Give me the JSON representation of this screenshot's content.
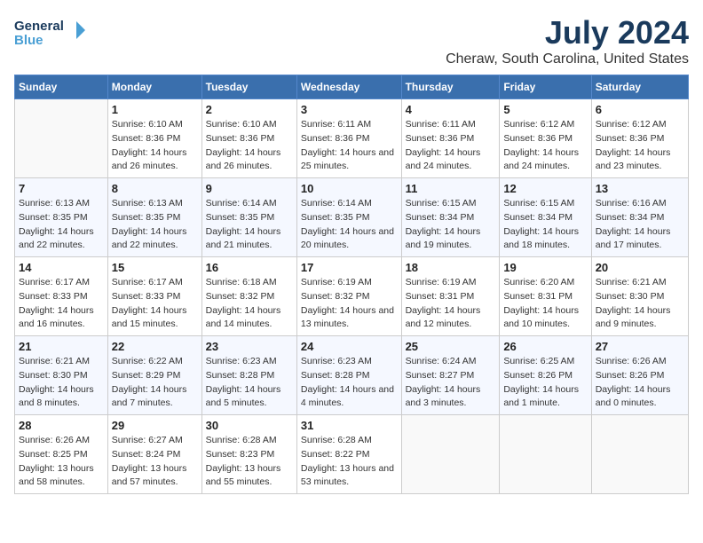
{
  "header": {
    "logo_line1": "General",
    "logo_line2": "Blue",
    "month_year": "July 2024",
    "location": "Cheraw, South Carolina, United States"
  },
  "days_of_week": [
    "Sunday",
    "Monday",
    "Tuesday",
    "Wednesday",
    "Thursday",
    "Friday",
    "Saturday"
  ],
  "weeks": [
    [
      {
        "day": "",
        "sunrise": "",
        "sunset": "",
        "daylight": ""
      },
      {
        "day": "1",
        "sunrise": "Sunrise: 6:10 AM",
        "sunset": "Sunset: 8:36 PM",
        "daylight": "Daylight: 14 hours and 26 minutes."
      },
      {
        "day": "2",
        "sunrise": "Sunrise: 6:10 AM",
        "sunset": "Sunset: 8:36 PM",
        "daylight": "Daylight: 14 hours and 26 minutes."
      },
      {
        "day": "3",
        "sunrise": "Sunrise: 6:11 AM",
        "sunset": "Sunset: 8:36 PM",
        "daylight": "Daylight: 14 hours and 25 minutes."
      },
      {
        "day": "4",
        "sunrise": "Sunrise: 6:11 AM",
        "sunset": "Sunset: 8:36 PM",
        "daylight": "Daylight: 14 hours and 24 minutes."
      },
      {
        "day": "5",
        "sunrise": "Sunrise: 6:12 AM",
        "sunset": "Sunset: 8:36 PM",
        "daylight": "Daylight: 14 hours and 24 minutes."
      },
      {
        "day": "6",
        "sunrise": "Sunrise: 6:12 AM",
        "sunset": "Sunset: 8:36 PM",
        "daylight": "Daylight: 14 hours and 23 minutes."
      }
    ],
    [
      {
        "day": "7",
        "sunrise": "Sunrise: 6:13 AM",
        "sunset": "Sunset: 8:35 PM",
        "daylight": "Daylight: 14 hours and 22 minutes."
      },
      {
        "day": "8",
        "sunrise": "Sunrise: 6:13 AM",
        "sunset": "Sunset: 8:35 PM",
        "daylight": "Daylight: 14 hours and 22 minutes."
      },
      {
        "day": "9",
        "sunrise": "Sunrise: 6:14 AM",
        "sunset": "Sunset: 8:35 PM",
        "daylight": "Daylight: 14 hours and 21 minutes."
      },
      {
        "day": "10",
        "sunrise": "Sunrise: 6:14 AM",
        "sunset": "Sunset: 8:35 PM",
        "daylight": "Daylight: 14 hours and 20 minutes."
      },
      {
        "day": "11",
        "sunrise": "Sunrise: 6:15 AM",
        "sunset": "Sunset: 8:34 PM",
        "daylight": "Daylight: 14 hours and 19 minutes."
      },
      {
        "day": "12",
        "sunrise": "Sunrise: 6:15 AM",
        "sunset": "Sunset: 8:34 PM",
        "daylight": "Daylight: 14 hours and 18 minutes."
      },
      {
        "day": "13",
        "sunrise": "Sunrise: 6:16 AM",
        "sunset": "Sunset: 8:34 PM",
        "daylight": "Daylight: 14 hours and 17 minutes."
      }
    ],
    [
      {
        "day": "14",
        "sunrise": "Sunrise: 6:17 AM",
        "sunset": "Sunset: 8:33 PM",
        "daylight": "Daylight: 14 hours and 16 minutes."
      },
      {
        "day": "15",
        "sunrise": "Sunrise: 6:17 AM",
        "sunset": "Sunset: 8:33 PM",
        "daylight": "Daylight: 14 hours and 15 minutes."
      },
      {
        "day": "16",
        "sunrise": "Sunrise: 6:18 AM",
        "sunset": "Sunset: 8:32 PM",
        "daylight": "Daylight: 14 hours and 14 minutes."
      },
      {
        "day": "17",
        "sunrise": "Sunrise: 6:19 AM",
        "sunset": "Sunset: 8:32 PM",
        "daylight": "Daylight: 14 hours and 13 minutes."
      },
      {
        "day": "18",
        "sunrise": "Sunrise: 6:19 AM",
        "sunset": "Sunset: 8:31 PM",
        "daylight": "Daylight: 14 hours and 12 minutes."
      },
      {
        "day": "19",
        "sunrise": "Sunrise: 6:20 AM",
        "sunset": "Sunset: 8:31 PM",
        "daylight": "Daylight: 14 hours and 10 minutes."
      },
      {
        "day": "20",
        "sunrise": "Sunrise: 6:21 AM",
        "sunset": "Sunset: 8:30 PM",
        "daylight": "Daylight: 14 hours and 9 minutes."
      }
    ],
    [
      {
        "day": "21",
        "sunrise": "Sunrise: 6:21 AM",
        "sunset": "Sunset: 8:30 PM",
        "daylight": "Daylight: 14 hours and 8 minutes."
      },
      {
        "day": "22",
        "sunrise": "Sunrise: 6:22 AM",
        "sunset": "Sunset: 8:29 PM",
        "daylight": "Daylight: 14 hours and 7 minutes."
      },
      {
        "day": "23",
        "sunrise": "Sunrise: 6:23 AM",
        "sunset": "Sunset: 8:28 PM",
        "daylight": "Daylight: 14 hours and 5 minutes."
      },
      {
        "day": "24",
        "sunrise": "Sunrise: 6:23 AM",
        "sunset": "Sunset: 8:28 PM",
        "daylight": "Daylight: 14 hours and 4 minutes."
      },
      {
        "day": "25",
        "sunrise": "Sunrise: 6:24 AM",
        "sunset": "Sunset: 8:27 PM",
        "daylight": "Daylight: 14 hours and 3 minutes."
      },
      {
        "day": "26",
        "sunrise": "Sunrise: 6:25 AM",
        "sunset": "Sunset: 8:26 PM",
        "daylight": "Daylight: 14 hours and 1 minute."
      },
      {
        "day": "27",
        "sunrise": "Sunrise: 6:26 AM",
        "sunset": "Sunset: 8:26 PM",
        "daylight": "Daylight: 14 hours and 0 minutes."
      }
    ],
    [
      {
        "day": "28",
        "sunrise": "Sunrise: 6:26 AM",
        "sunset": "Sunset: 8:25 PM",
        "daylight": "Daylight: 13 hours and 58 minutes."
      },
      {
        "day": "29",
        "sunrise": "Sunrise: 6:27 AM",
        "sunset": "Sunset: 8:24 PM",
        "daylight": "Daylight: 13 hours and 57 minutes."
      },
      {
        "day": "30",
        "sunrise": "Sunrise: 6:28 AM",
        "sunset": "Sunset: 8:23 PM",
        "daylight": "Daylight: 13 hours and 55 minutes."
      },
      {
        "day": "31",
        "sunrise": "Sunrise: 6:28 AM",
        "sunset": "Sunset: 8:22 PM",
        "daylight": "Daylight: 13 hours and 53 minutes."
      },
      {
        "day": "",
        "sunrise": "",
        "sunset": "",
        "daylight": ""
      },
      {
        "day": "",
        "sunrise": "",
        "sunset": "",
        "daylight": ""
      },
      {
        "day": "",
        "sunrise": "",
        "sunset": "",
        "daylight": ""
      }
    ]
  ]
}
